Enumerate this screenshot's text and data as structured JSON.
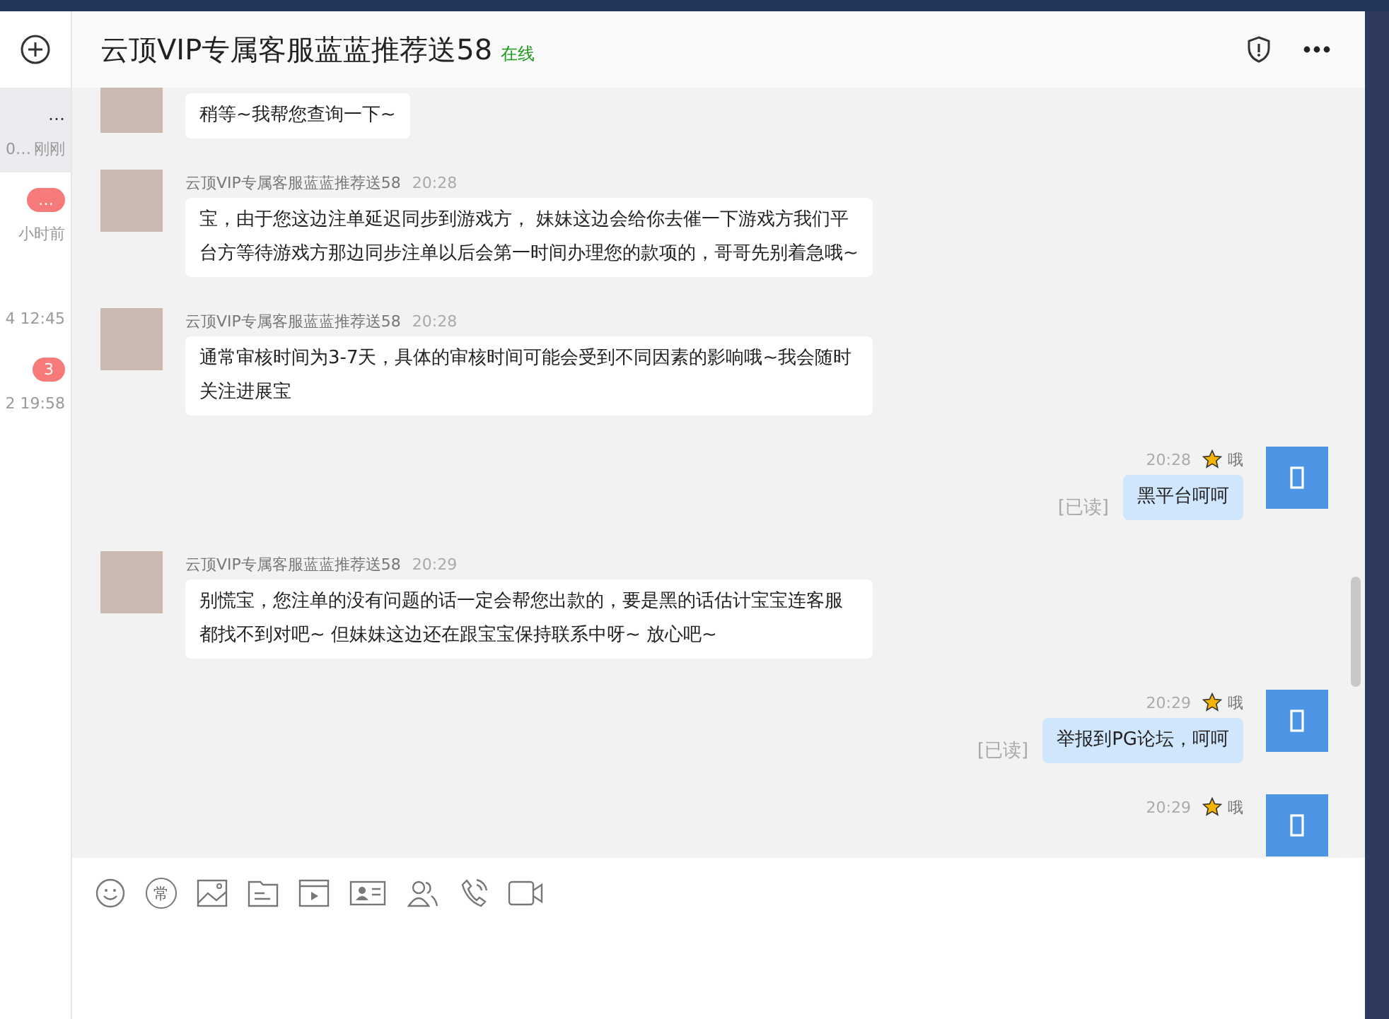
{
  "sidebar": {
    "items": [
      {
        "line1": "…",
        "line2": "0…",
        "time": "刚刚",
        "selected": true
      },
      {
        "time": "小时前",
        "badge": "…",
        "selected": false
      },
      {
        "time": "4 12:45",
        "selected": false
      },
      {
        "time": "2 19:58",
        "badge": "3",
        "selected": false
      }
    ]
  },
  "chat": {
    "title": "云顶VIP专属客服蓝蓝推荐送58",
    "status": "在线"
  },
  "messages": [
    {
      "kind": "incoming",
      "text": "稍等~我帮您查询一下~"
    },
    {
      "kind": "incoming",
      "name": "云顶VIP专属客服蓝蓝推荐送58",
      "time": "20:28",
      "text": "宝，由于您这边注单延迟同步到游戏方， 妹妹这边会给你去催一下游戏方我们平台方等待游戏方那边同步注单以后会第一时间办理您的款项的，哥哥先别着急哦~"
    },
    {
      "kind": "incoming",
      "name": "云顶VIP专属客服蓝蓝推荐送58",
      "time": "20:28",
      "text": "通常审核时间为3-7天，具体的审核时间可能会受到不同因素的影响哦~我会随时关注进展宝"
    },
    {
      "kind": "outgoing",
      "name": "哦",
      "time": "20:28",
      "text": "黑平台呵呵",
      "read": "[已读]"
    },
    {
      "kind": "incoming",
      "name": "云顶VIP专属客服蓝蓝推荐送58",
      "time": "20:29",
      "text": "别慌宝，您注单的没有问题的话一定会帮您出款的，要是黑的话估计宝宝连客服都找不到对吧~ 但妹妹这边还在跟宝宝保持联系中呀~ 放心吧~"
    },
    {
      "kind": "outgoing",
      "name": "哦",
      "time": "20:29",
      "text": "举报到PG论坛，呵呵",
      "read": "[已读]"
    },
    {
      "kind": "outgoing",
      "name": "哦",
      "time": "20:29"
    }
  ],
  "toolbar": [
    {
      "kind": "emoji"
    },
    {
      "kind": "label",
      "label": "常"
    },
    {
      "kind": "image"
    },
    {
      "kind": "file"
    },
    {
      "kind": "video"
    },
    {
      "kind": "card"
    },
    {
      "kind": "people"
    },
    {
      "kind": "phone"
    },
    {
      "kind": "camera"
    }
  ]
}
